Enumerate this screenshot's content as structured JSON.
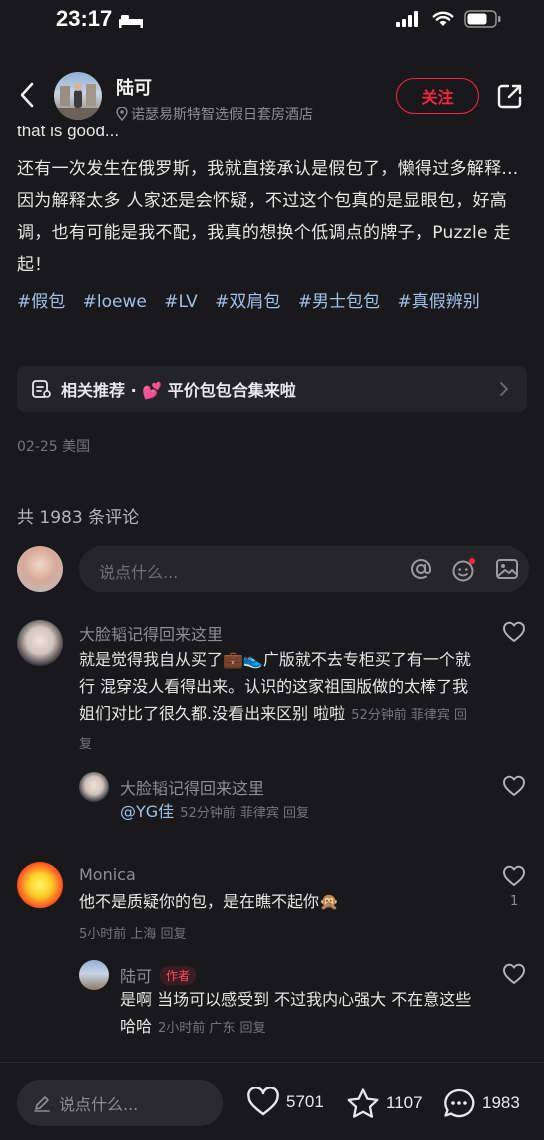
{
  "status_bar": {
    "time": "23:17"
  },
  "header": {
    "author_name": "陆可",
    "location": "诺瑟易斯特智选假日套房酒店",
    "follow_label": "关注"
  },
  "post": {
    "partial_line": "that is good...",
    "body": "还有一次发生在俄罗斯，我就直接承认是假包了，懒得过多解释...因为解释太多 人家还是会怀疑，不过这个包真的是显眼包，好高调，也有可能是我不配，我真的想换个低调点的牌子，Puzzle 走起！",
    "tags": [
      "#假包",
      "#loewe",
      "#LV",
      "#双肩包",
      "#男士包包",
      "#真假辨别"
    ],
    "related_label": "相关推荐 · 💕 平价包包合集来啦",
    "date_location": "02-25 美国"
  },
  "comments_header": "共 1983 条评论",
  "comment_input": {
    "placeholder": "说点什么..."
  },
  "comments": [
    {
      "name": "大脸韬记得回来这里",
      "text": "就是觉得我自从买了💼👟广版就不去专柜买了有一个就行 混穿没人看得出来。认识的这家祖国版做的太棒了我姐们对比了很久都.没看出来区别 啦啦",
      "meta": "52分钟前 菲律宾 回复",
      "reply": {
        "name": "大脸韬记得回来这里",
        "text": "@YG佳",
        "meta": "52分钟前 菲律宾 回复"
      }
    },
    {
      "name": "Monica",
      "text": "他不是质疑你的包，是在瞧不起你🙊",
      "meta": "5小时前 上海 回复",
      "likes": "1",
      "reply": {
        "name": "陆可",
        "author_tag": "作者",
        "text": "是啊 当场可以感受到 不过我内心强大 不在意这些 哈哈",
        "meta": "2小时前 广东 回复"
      }
    }
  ],
  "bottom_bar": {
    "placeholder": "说点什么...",
    "likes": "5701",
    "favorites": "1107",
    "comments": "1983"
  },
  "colors": {
    "accent": "#ff2442",
    "tag": "#9fc0ea",
    "background": "#19191b"
  }
}
